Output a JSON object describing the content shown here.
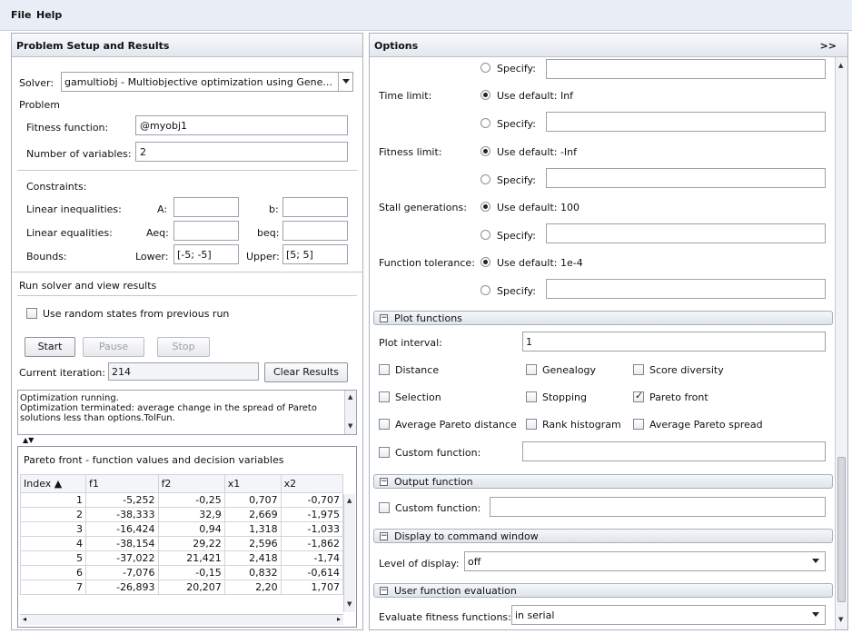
{
  "menu": [
    "File",
    "Help"
  ],
  "left": {
    "title": "Problem Setup and Results",
    "solver_label": "Solver:",
    "solver_value": "gamultiobj - Multiobjective optimization using Gene...",
    "problem_label": "Problem",
    "fitness_label": "Fitness function:",
    "fitness_value": "@myobj1",
    "nvars_label": "Number of variables:",
    "nvars_value": "2",
    "constraints_label": "Constraints:",
    "lin_ineq_label": "Linear inequalities:",
    "A_label": "A:",
    "b_label": "b:",
    "lin_eq_label": "Linear equalities:",
    "Aeq_label": "Aeq:",
    "beq_label": "beq:",
    "bounds_label": "Bounds:",
    "lower_label": "Lower:",
    "lower_value": "[-5; -5]",
    "upper_label": "Upper:",
    "upper_value": "[5; 5]",
    "run_label": "Run solver and view results",
    "random_states_label": "Use random states from previous run",
    "start": "Start",
    "pause": "Pause",
    "stop": "Stop",
    "iter_label": "Current iteration:",
    "iter_value": "214",
    "clear": "Clear Results",
    "status_line1": "Optimization running.",
    "status_line2": "Optimization terminated: average change in the spread of Pareto",
    "status_line3": "solutions less than options.TolFun.",
    "pareto_title": "Pareto front - function values and decision variables",
    "columns": [
      "Index ▲",
      "f1",
      "f2",
      "x1",
      "x2"
    ],
    "rows": [
      [
        "1",
        "-5,252",
        "-0,25",
        "0,707",
        "-0,707"
      ],
      [
        "2",
        "-38,333",
        "32,9",
        "2,669",
        "-1,975"
      ],
      [
        "3",
        "-16,424",
        "0,94",
        "1,318",
        "-1,033"
      ],
      [
        "4",
        "-38,154",
        "29,22",
        "2,596",
        "-1,862"
      ],
      [
        "5",
        "-37,022",
        "21,421",
        "2,418",
        "-1,74"
      ],
      [
        "6",
        "-7,076",
        "-0,15",
        "0,832",
        "-0,614"
      ],
      [
        "7",
        "-26,893",
        "20,207",
        "2,20",
        "1,707"
      ]
    ]
  },
  "right": {
    "title": "Options",
    "collapse": ">>",
    "specify": "Specify:",
    "time_limit": "Time limit:",
    "time_default": "Use default: Inf",
    "fitness_limit": "Fitness limit:",
    "fitness_default": "Use default: -Inf",
    "stall_label": "Stall generations:",
    "stall_default": "Use default: 100",
    "tol_label": "Function tolerance:",
    "tol_default": "Use default: 1e-4",
    "plot_section": "Plot functions",
    "plot_interval_label": "Plot interval:",
    "plot_interval_value": "1",
    "plots": {
      "distance": "Distance",
      "genealogy": "Genealogy",
      "score_diversity": "Score diversity",
      "selection": "Selection",
      "stopping": "Stopping",
      "pareto_front": "Pareto front",
      "avg_pareto_distance": "Average Pareto distance",
      "rank_histogram": "Rank histogram",
      "avg_pareto_spread": "Average Pareto spread"
    },
    "custom_function": "Custom function:",
    "output_section": "Output function",
    "display_section": "Display to command window",
    "level_label": "Level of display:",
    "level_value": "off",
    "user_eval_section": "User function evaluation",
    "evaluate_label": "Evaluate fitness functions:",
    "evaluate_value": "in serial"
  }
}
